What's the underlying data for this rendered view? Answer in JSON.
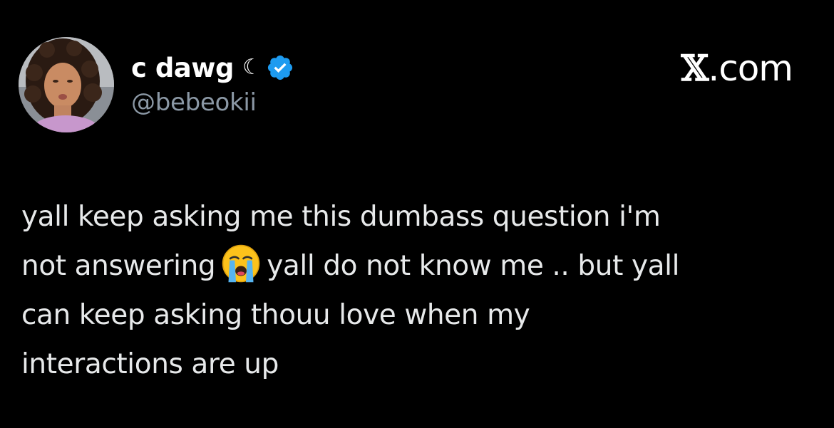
{
  "tweet": {
    "author": {
      "display_name": "c dawg",
      "name_glyph": "☾",
      "handle": "@bebeokii",
      "verified_color": "#1d9bf0"
    },
    "brand": {
      "x_glyph": "𝕏",
      "suffix": ".com"
    },
    "text_lines": {
      "line1": "yall keep asking me this dumbass question i'm",
      "line2_before_emoji": "not answering",
      "line2_emoji": "loudly-crying-face",
      "line2_after_emoji": "yall do not know me .. but yall",
      "line3": "can keep asking thouu love when my",
      "line4": "interactions are up"
    },
    "colors": {
      "background": "#000000",
      "primary_text": "#e7e9ea",
      "secondary_text": "#8b98a5"
    }
  }
}
